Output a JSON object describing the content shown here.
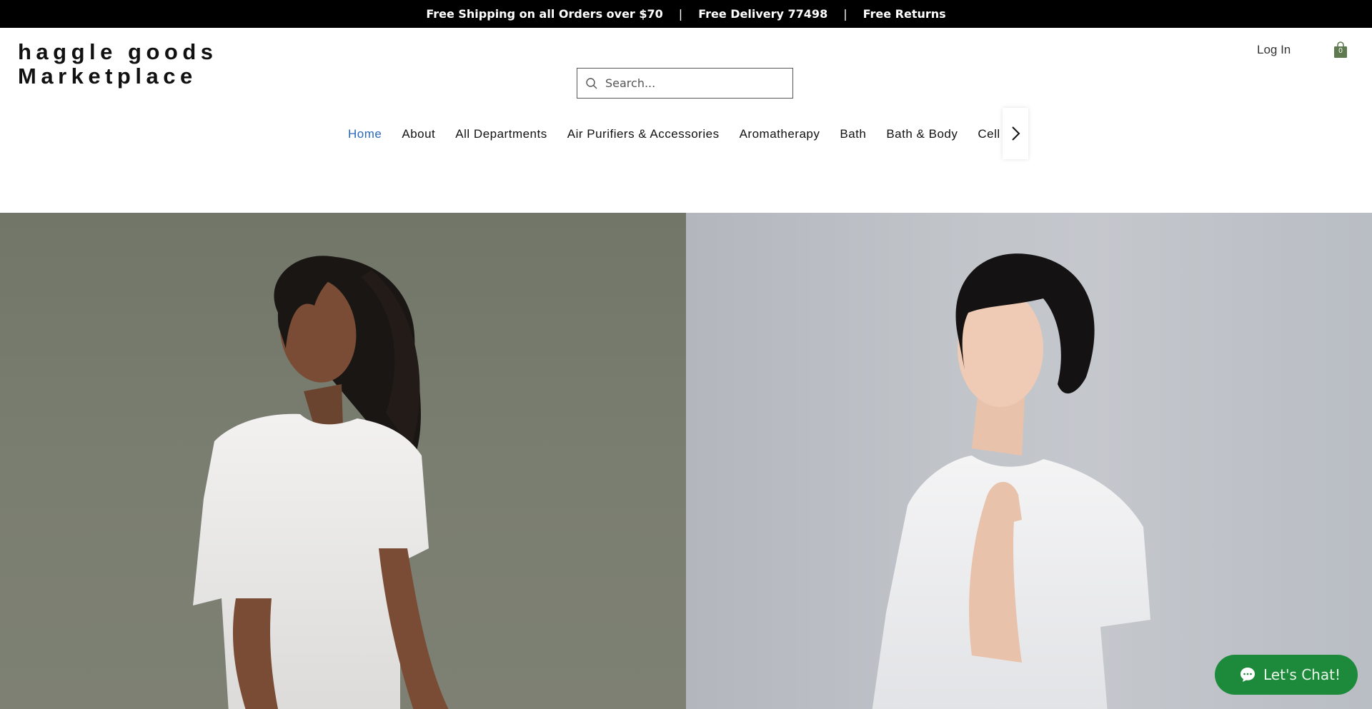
{
  "announcement": {
    "shipping": "Free Shipping on all Orders over $70",
    "separator": "|",
    "delivery": "Free Delivery 77498",
    "returns": "Free Returns"
  },
  "logo": {
    "line1": "haggle goods",
    "line2": "Marketplace"
  },
  "header": {
    "login_label": "Log In",
    "cart_count": "0"
  },
  "search": {
    "placeholder": "Search..."
  },
  "nav": {
    "items": [
      {
        "label": "Home"
      },
      {
        "label": "About"
      },
      {
        "label": "All Departments"
      },
      {
        "label": "Air Purifiers & Accessories"
      },
      {
        "label": "Aromatherapy"
      },
      {
        "label": "Bath"
      },
      {
        "label": "Bath & Body"
      },
      {
        "label": "Cell Phones"
      }
    ],
    "active_index": 0
  },
  "chat": {
    "label": "Let's Chat!"
  },
  "colors": {
    "nav_active": "#2a6ab8",
    "chat_bg": "#1d8a3b",
    "cart": "#5f7a4e"
  }
}
